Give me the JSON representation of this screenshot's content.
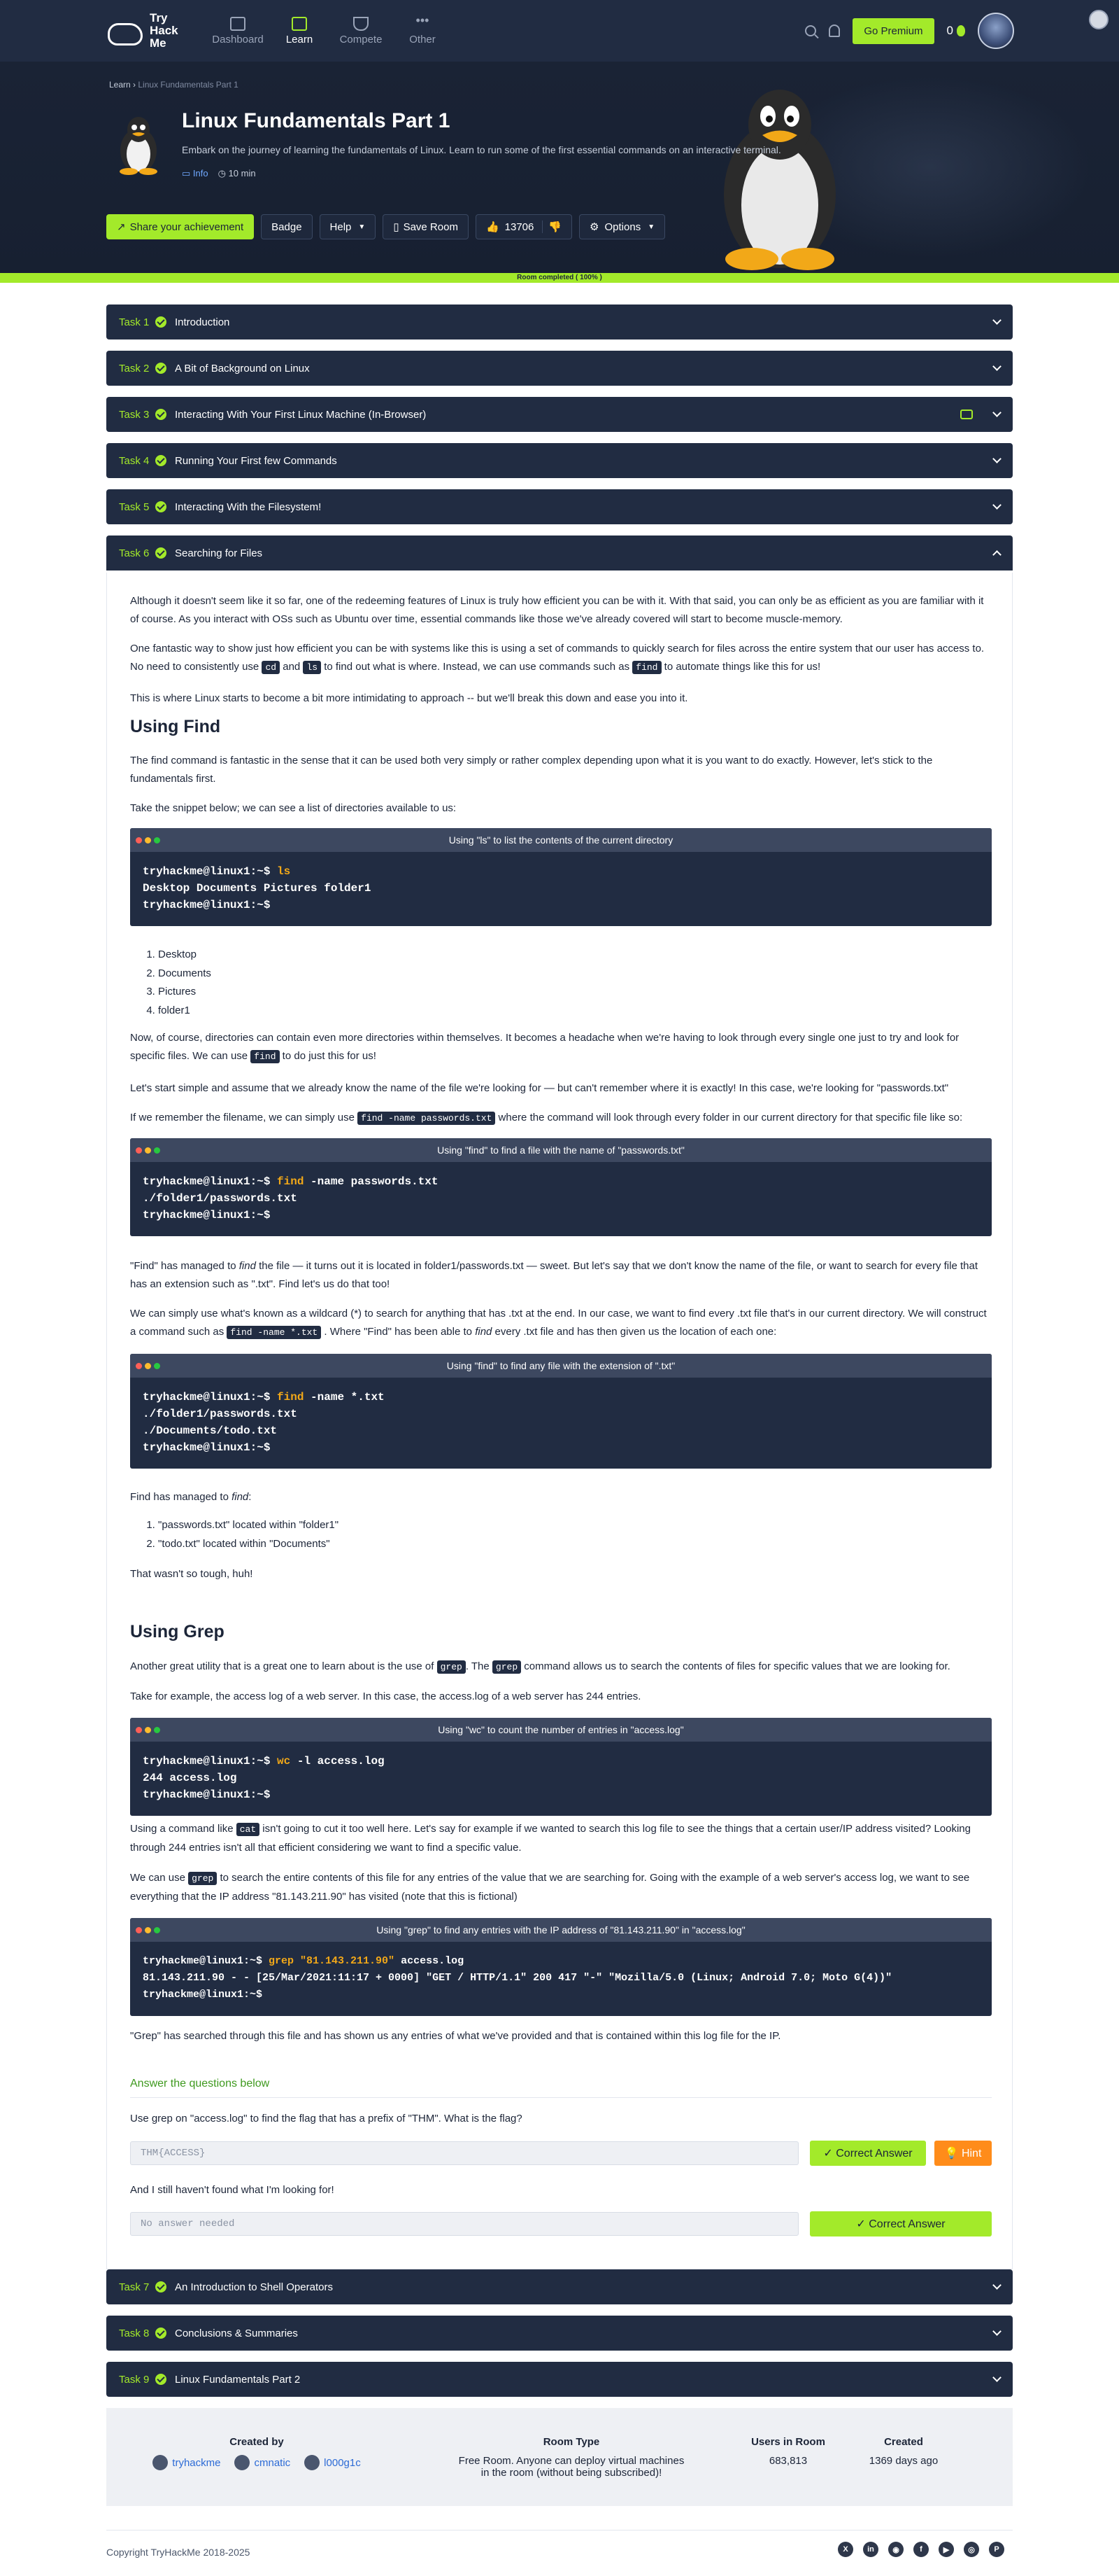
{
  "nav": {
    "logo": "Try Hack Me",
    "items": [
      {
        "label": "Dashboard"
      },
      {
        "label": "Learn"
      },
      {
        "label": "Compete"
      },
      {
        "label": "Other"
      }
    ],
    "premium": "Go Premium",
    "streak": "0"
  },
  "hero": {
    "breadcrumb_root": "Learn",
    "breadcrumb_sep": " › ",
    "breadcrumb_current": "Linux Fundamentals Part 1",
    "title": "Linux Fundamentals Part 1",
    "description": "Embark on the journey of learning the fundamentals of Linux. Learn to run some of the first essential commands on an interactive terminal.",
    "info": "Info",
    "duration": "10 min",
    "buttons": {
      "share": "Share your achievement",
      "badge": "Badge",
      "help": "Help",
      "save": "Save Room",
      "likes": "13706",
      "options": "Options"
    }
  },
  "progress_label": "Room completed ( 100% )",
  "tasks": [
    {
      "num": "Task 1",
      "title": "Introduction"
    },
    {
      "num": "Task 2",
      "title": "A Bit of Background on Linux"
    },
    {
      "num": "Task 3",
      "title": "Interacting With Your First Linux Machine (In-Browser)"
    },
    {
      "num": "Task 4",
      "title": "Running Your First few Commands"
    },
    {
      "num": "Task 5",
      "title": "Interacting With the Filesystem!"
    },
    {
      "num": "Task 6",
      "title": "Searching for Files"
    },
    {
      "num": "Task 7",
      "title": "An Introduction to Shell Operators"
    },
    {
      "num": "Task 8",
      "title": "Conclusions & Summaries"
    },
    {
      "num": "Task 9",
      "title": "Linux Fundamentals Part 2"
    }
  ],
  "content": {
    "p1": "Although it doesn't seem like it so far, one of the redeeming features of Linux is truly how efficient you can be with it. With that said, you can only be as efficient as you are familiar with it of course. As you interact with OSs such as Ubuntu over time, essential commands like those we've already covered will start to become muscle-memory.",
    "p2a": "One fantastic way to show just how efficient you can be with systems like this is using a set of commands to quickly search for files across the entire system that our user has access to. No need to consistently use ",
    "p2_cd": "cd",
    "p2b": " and ",
    "p2_ls": "ls",
    "p2c": " to find out what is where. Instead, we can use commands such as ",
    "p2_find": "find",
    "p2d": " to automate things like this for us!",
    "p3": "This is where Linux starts to become a bit more intimidating to approach -- but we'll break this down and ease you into it.",
    "h_find": "Using Find",
    "p4": "The find command is fantastic in the sense that it can be used both very simply or rather complex depending upon what it is you want to do exactly. However, let's stick to the fundamentals first.",
    "p5": "Take the snippet below; we can see a list of directories available to us:",
    "t1_title": "Using \"ls\" to list the contents of the current directory",
    "t1_prompt": "tryhackme@linux1:~$ ",
    "t1_cmd": "ls",
    "t1_out": "Desktop Documents Pictures folder1",
    "t1_prompt2": "tryhackme@linux1:~$",
    "list1": [
      "Desktop",
      "Documents",
      "Pictures",
      "folder1"
    ],
    "p6a": "Now, of course, directories can contain even more directories within themselves. It becomes a headache when we're having to look through every single one just to try and look for specific files. We can use ",
    "p6_find": "find",
    "p6b": " to do just this for us!",
    "p7": "Let's start simple and assume that we already know the name of the file we're looking for — but can't remember where it is exactly! In this case, we're looking for \"passwords.txt\"",
    "p8a": "If we remember the filename, we can simply use ",
    "p8_code": "find -name passwords.txt",
    "p8b": " where the command will look through every folder in our current directory for that specific file like so:",
    "t2_title": "Using \"find\" to find a file with the name of \"passwords.txt\"",
    "t2_prompt": "tryhackme@linux1:~$ ",
    "t2_cmd": "find",
    "t2_args": " -name passwords.txt",
    "t2_out": "./folder1/passwords.txt",
    "t2_prompt2": "tryhackme@linux1:~$",
    "p9a": "\"Find\" has managed to ",
    "p9_em": "find",
    "p9b": " the file — it turns out it is located in folder1/passwords.txt — sweet. But let's say that we don't know the name of the file, or want to search for every file that has an extension such as \".txt\". Find let's us do that too!",
    "p10a": "We can simply use what's known as a wildcard (*) to search for anything that has .txt at the end. In our case, we want to find every .txt file that's in our current directory. We will construct a command such as ",
    "p10_code": "find -name *.txt",
    "p10b": " . Where \"Find\" has been able to ",
    "p10_em": "find",
    "p10c": " every .txt file and has then given us the location of each one:",
    "t3_title": "Using \"find\" to find any file with the extension of \".txt\"",
    "t3_prompt": "tryhackme@linux1:~$ ",
    "t3_cmd": "find",
    "t3_args": " -name *.txt",
    "t3_out1": "./folder1/passwords.txt",
    "t3_out2": "./Documents/todo.txt",
    "t3_prompt2": "tryhackme@linux1:~$",
    "p11a": "Find has managed to ",
    "p11_em": "find",
    "p11b": ":",
    "list2": [
      "\"passwords.txt\" located within \"folder1\"",
      "\"todo.txt\" located within \"Documents\""
    ],
    "p12": "That wasn't so tough, huh!",
    "h_grep": "Using Grep",
    "p13a": "Another great utility that is a great one to learn about is the use of ",
    "p13_grep": "grep",
    "p13b": ". The ",
    "p13_grep2": "grep",
    "p13c": " command allows us to search the contents of files for specific values that we are looking for.",
    "p14": "Take for example, the access log of a web server. In this case, the access.log of a web server has 244 entries.",
    "t4_title": "Using \"wc\" to count the number of entries in \"access.log\"",
    "t4_prompt": "tryhackme@linux1:~$ ",
    "t4_cmd": "wc",
    "t4_args": " -l access.log",
    "t4_out": "244 access.log",
    "t4_prompt2": "tryhackme@linux1:~$",
    "p15a": "Using a command like ",
    "p15_cat": "cat",
    "p15b": " isn't going to cut it too well here. Let's say for example if we wanted to search this log file to see the things that a certain user/IP address visited? Looking through 244 entries isn't all that efficient considering we want to find a specific value.",
    "p16a": "We can use ",
    "p16_grep": "grep",
    "p16b": " to search the entire contents of this file for any entries of the value that we are searching for. Going with the example of a web server's access log, we want to see everything that the IP address \"81.143.211.90\" has visited (note that this is fictional)",
    "t5_title": "Using \"grep\" to find any entries with the IP address of \"81.143.211.90\" in \"access.log\"",
    "t5_prompt": "tryhackme@linux1:~$ ",
    "t5_cmd": "grep \"81.143.211.90\"",
    "t5_args": " access.log",
    "t5_out": "81.143.211.90 - - [25/Mar/2021:11:17 + 0000] \"GET / HTTP/1.1\" 200 417 \"-\" \"Mozilla/5.0 (Linux; Android 7.0; Moto G(4))\"",
    "t5_prompt2": "tryhackme@linux1:~$",
    "p17": "\"Grep\" has searched through this file and has shown us any entries of what we've provided and that is contained within this log file for the IP."
  },
  "answers": {
    "header": "Answer the questions below",
    "q1": "Use grep on \"access.log\" to find the flag that has a prefix of \"THM\". What is the flag?",
    "a1": "THM{ACCESS}",
    "correct": "✓  Correct Answer",
    "hint": "💡 Hint",
    "q2": "And I still haven't found what I'm looking for!",
    "a2": "No answer needed"
  },
  "room_info": {
    "created_by_label": "Created by",
    "creators": [
      "tryhackme",
      "cmnatic",
      "l000g1c"
    ],
    "room_type_label": "Room Type",
    "room_type_1": "Free Room. Anyone can deploy virtual machines",
    "room_type_2": "in the room (without being subscribed)!",
    "users_label": "Users in Room",
    "users": "683,813",
    "created_label": "Created",
    "created": "1369 days ago"
  },
  "footer": {
    "copyright": "Copyright TryHackMe 2018-2025",
    "socials": [
      "x-icon",
      "linkedin-icon",
      "discord-icon",
      "facebook-icon",
      "youtube-icon",
      "instagram-icon",
      "pinterest-icon"
    ]
  },
  "colors": {
    "accent": "#a3ea2a",
    "navy": "#212c42",
    "hint": "#ff8c1a"
  }
}
